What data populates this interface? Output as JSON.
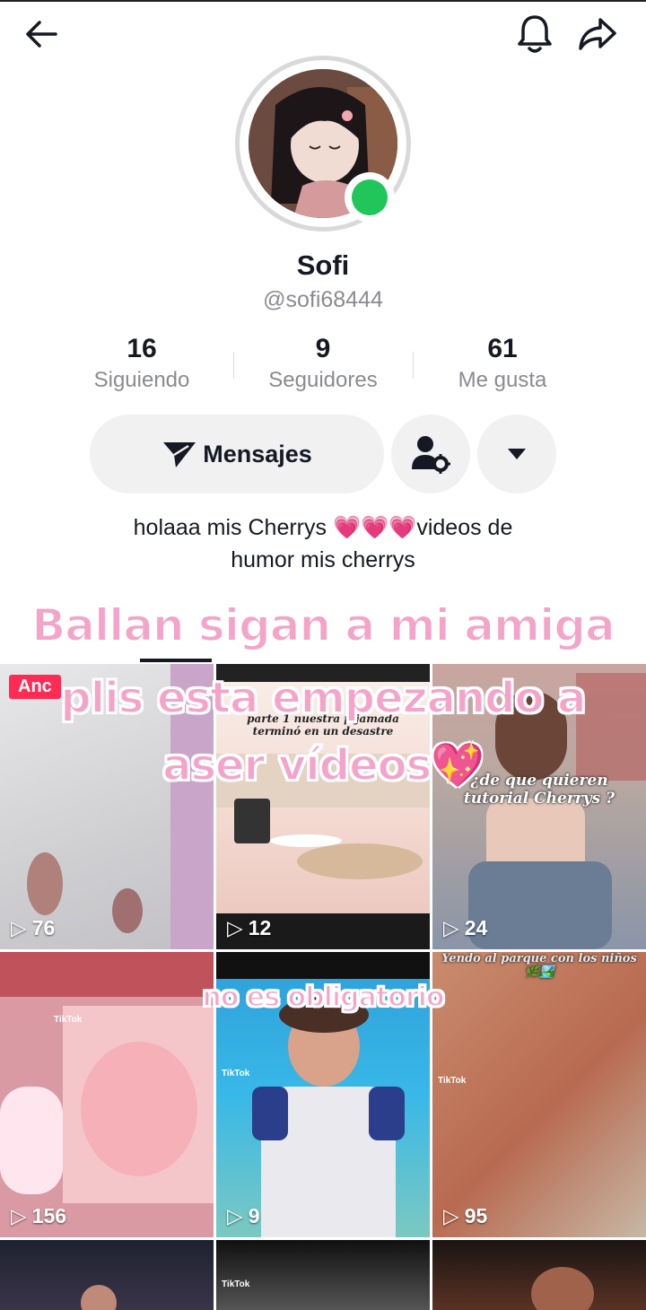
{
  "header": {
    "back_icon": "arrow-left-icon",
    "bell_icon": "bell-icon",
    "share_icon": "share-icon"
  },
  "profile": {
    "name": "Sofi",
    "handle": "@sofi68444",
    "online": true,
    "online_color": "#20c65a"
  },
  "stats": [
    {
      "value": "16",
      "label": "Siguiendo"
    },
    {
      "value": "9",
      "label": "Seguidores"
    },
    {
      "value": "61",
      "label": "Me gusta"
    }
  ],
  "actions": {
    "message_label": "Mensajes",
    "add_friend_icon": "user-settings-icon",
    "more_icon": "caret-down-icon"
  },
  "bio": {
    "line1": "holaaa mis Cherrys 💗💗💗videos de",
    "line2": "humor mis cherrys"
  },
  "overlay_text": {
    "line1": "Ballan sigan a mi amiga",
    "line2": "plis esta empezando a",
    "line3": "aser vídeos💖",
    "line4": "no es obligatorio"
  },
  "videos": [
    {
      "views": "76",
      "badge": "Anc"
    },
    {
      "views": "12",
      "caption": "parte 1 nuestra pijamada terminó en un desastre"
    },
    {
      "views": "24",
      "caption": "¿de que quieren tutorial Cherrys ?"
    },
    {
      "views": "156",
      "tag": "TikTok"
    },
    {
      "views": "9",
      "tag": "TikTok"
    },
    {
      "views": "95",
      "caption": "Yendo al parque con los niños 🌿🏞️",
      "tag": "TikTok"
    },
    {
      "views": ""
    },
    {
      "views": "",
      "tag": "TikTok"
    },
    {
      "views": ""
    }
  ],
  "colors": {
    "accent_pink": "#f4a3c9",
    "pin_red": "#fe2c55",
    "button_bg": "#f1f1f2",
    "muted_text": "#8a8b91"
  }
}
